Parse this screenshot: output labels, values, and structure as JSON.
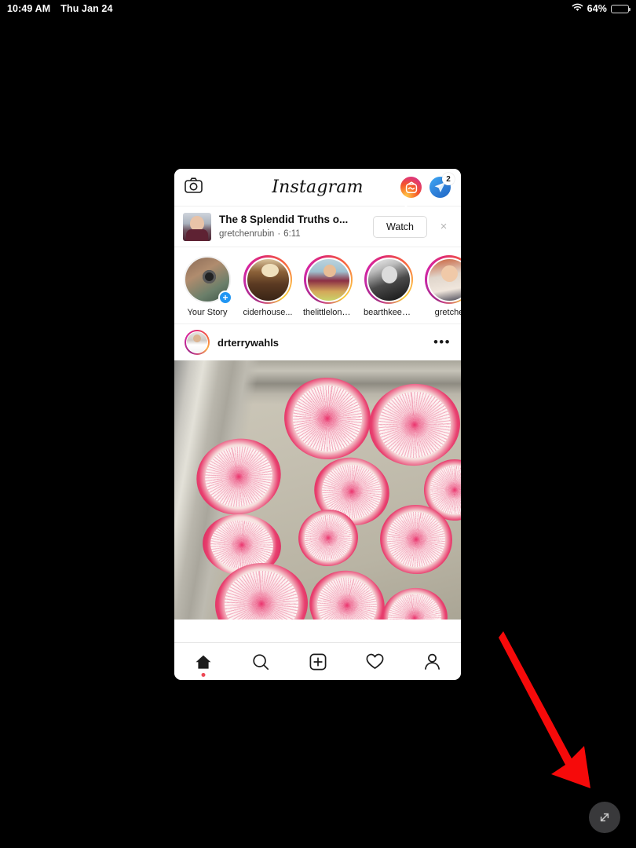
{
  "statusbar": {
    "time": "10:49 AM",
    "date": "Thu Jan 24",
    "battery_percent": "64%",
    "battery_level": 64,
    "wifi_icon": "wifi-icon",
    "battery_icon": "battery-icon"
  },
  "instagram": {
    "header": {
      "camera_icon": "camera-icon",
      "logo": "Instagram",
      "igtv_icon": "igtv-icon",
      "messenger_icon": "messenger-paper-plane-icon",
      "messenger_badge": "2"
    },
    "igtv_banner": {
      "title": "The 8 Splendid Truths o...",
      "author": "gretchenrubin",
      "separator": "·",
      "duration": "6:11",
      "watch_label": "Watch",
      "close_icon": "×"
    },
    "stories": [
      {
        "label": "Your Story",
        "has_ring": false,
        "has_plus": true
      },
      {
        "label": "ciderhouse...",
        "has_ring": true,
        "has_plus": false
      },
      {
        "label": "thelittlelond...",
        "has_ring": true,
        "has_plus": false
      },
      {
        "label": "bearthkeeper",
        "has_ring": true,
        "has_plus": false
      },
      {
        "label": "gretche",
        "has_ring": true,
        "has_plus": false
      }
    ],
    "post": {
      "username": "drterrywahls",
      "more_icon": "•••",
      "photo_alt": "watermelon radish slices on a metal baking tray"
    },
    "nav": [
      {
        "name": "home",
        "active": true
      },
      {
        "name": "search",
        "active": false
      },
      {
        "name": "add-post",
        "active": false
      },
      {
        "name": "activity",
        "active": false
      },
      {
        "name": "profile",
        "active": false
      }
    ]
  },
  "annotation": {
    "arrow_color": "#f60a0a",
    "arrow_name": "red-pointer-arrow"
  },
  "expand_button": {
    "icon": "expand-diagonal-arrows-icon",
    "background": "#39393b"
  },
  "colors": {
    "screen_background": "#000000",
    "window_background": "#ffffff",
    "accent_blue": "#2196f3",
    "notification_red": "#ed4956",
    "arrow_red": "#f60a0a"
  }
}
